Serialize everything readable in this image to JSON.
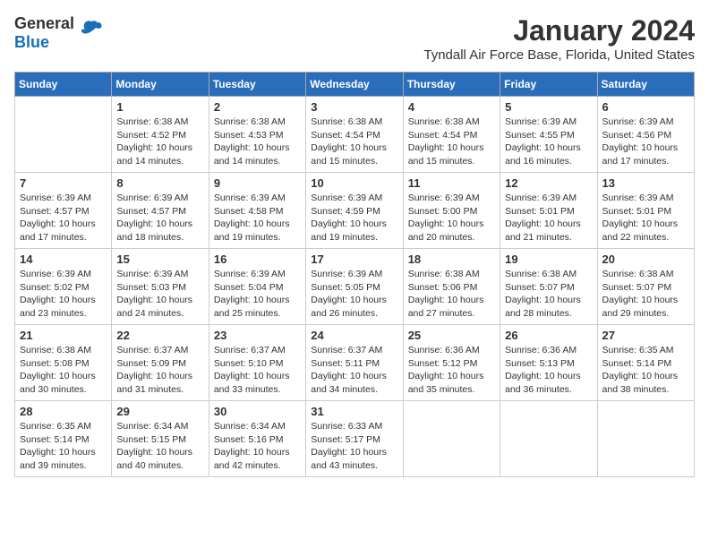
{
  "logo": {
    "general": "General",
    "blue": "Blue"
  },
  "title": "January 2024",
  "location": "Tyndall Air Force Base, Florida, United States",
  "days": [
    "Sunday",
    "Monday",
    "Tuesday",
    "Wednesday",
    "Thursday",
    "Friday",
    "Saturday"
  ],
  "weeks": [
    [
      {
        "date": "",
        "info": ""
      },
      {
        "date": "1",
        "info": "Sunrise: 6:38 AM\nSunset: 4:52 PM\nDaylight: 10 hours\nand 14 minutes."
      },
      {
        "date": "2",
        "info": "Sunrise: 6:38 AM\nSunset: 4:53 PM\nDaylight: 10 hours\nand 14 minutes."
      },
      {
        "date": "3",
        "info": "Sunrise: 6:38 AM\nSunset: 4:54 PM\nDaylight: 10 hours\nand 15 minutes."
      },
      {
        "date": "4",
        "info": "Sunrise: 6:38 AM\nSunset: 4:54 PM\nDaylight: 10 hours\nand 15 minutes."
      },
      {
        "date": "5",
        "info": "Sunrise: 6:39 AM\nSunset: 4:55 PM\nDaylight: 10 hours\nand 16 minutes."
      },
      {
        "date": "6",
        "info": "Sunrise: 6:39 AM\nSunset: 4:56 PM\nDaylight: 10 hours\nand 17 minutes."
      }
    ],
    [
      {
        "date": "7",
        "info": "Sunrise: 6:39 AM\nSunset: 4:57 PM\nDaylight: 10 hours\nand 17 minutes."
      },
      {
        "date": "8",
        "info": "Sunrise: 6:39 AM\nSunset: 4:57 PM\nDaylight: 10 hours\nand 18 minutes."
      },
      {
        "date": "9",
        "info": "Sunrise: 6:39 AM\nSunset: 4:58 PM\nDaylight: 10 hours\nand 19 minutes."
      },
      {
        "date": "10",
        "info": "Sunrise: 6:39 AM\nSunset: 4:59 PM\nDaylight: 10 hours\nand 19 minutes."
      },
      {
        "date": "11",
        "info": "Sunrise: 6:39 AM\nSunset: 5:00 PM\nDaylight: 10 hours\nand 20 minutes."
      },
      {
        "date": "12",
        "info": "Sunrise: 6:39 AM\nSunset: 5:01 PM\nDaylight: 10 hours\nand 21 minutes."
      },
      {
        "date": "13",
        "info": "Sunrise: 6:39 AM\nSunset: 5:01 PM\nDaylight: 10 hours\nand 22 minutes."
      }
    ],
    [
      {
        "date": "14",
        "info": "Sunrise: 6:39 AM\nSunset: 5:02 PM\nDaylight: 10 hours\nand 23 minutes."
      },
      {
        "date": "15",
        "info": "Sunrise: 6:39 AM\nSunset: 5:03 PM\nDaylight: 10 hours\nand 24 minutes."
      },
      {
        "date": "16",
        "info": "Sunrise: 6:39 AM\nSunset: 5:04 PM\nDaylight: 10 hours\nand 25 minutes."
      },
      {
        "date": "17",
        "info": "Sunrise: 6:39 AM\nSunset: 5:05 PM\nDaylight: 10 hours\nand 26 minutes."
      },
      {
        "date": "18",
        "info": "Sunrise: 6:38 AM\nSunset: 5:06 PM\nDaylight: 10 hours\nand 27 minutes."
      },
      {
        "date": "19",
        "info": "Sunrise: 6:38 AM\nSunset: 5:07 PM\nDaylight: 10 hours\nand 28 minutes."
      },
      {
        "date": "20",
        "info": "Sunrise: 6:38 AM\nSunset: 5:07 PM\nDaylight: 10 hours\nand 29 minutes."
      }
    ],
    [
      {
        "date": "21",
        "info": "Sunrise: 6:38 AM\nSunset: 5:08 PM\nDaylight: 10 hours\nand 30 minutes."
      },
      {
        "date": "22",
        "info": "Sunrise: 6:37 AM\nSunset: 5:09 PM\nDaylight: 10 hours\nand 31 minutes."
      },
      {
        "date": "23",
        "info": "Sunrise: 6:37 AM\nSunset: 5:10 PM\nDaylight: 10 hours\nand 33 minutes."
      },
      {
        "date": "24",
        "info": "Sunrise: 6:37 AM\nSunset: 5:11 PM\nDaylight: 10 hours\nand 34 minutes."
      },
      {
        "date": "25",
        "info": "Sunrise: 6:36 AM\nSunset: 5:12 PM\nDaylight: 10 hours\nand 35 minutes."
      },
      {
        "date": "26",
        "info": "Sunrise: 6:36 AM\nSunset: 5:13 PM\nDaylight: 10 hours\nand 36 minutes."
      },
      {
        "date": "27",
        "info": "Sunrise: 6:35 AM\nSunset: 5:14 PM\nDaylight: 10 hours\nand 38 minutes."
      }
    ],
    [
      {
        "date": "28",
        "info": "Sunrise: 6:35 AM\nSunset: 5:14 PM\nDaylight: 10 hours\nand 39 minutes."
      },
      {
        "date": "29",
        "info": "Sunrise: 6:34 AM\nSunset: 5:15 PM\nDaylight: 10 hours\nand 40 minutes."
      },
      {
        "date": "30",
        "info": "Sunrise: 6:34 AM\nSunset: 5:16 PM\nDaylight: 10 hours\nand 42 minutes."
      },
      {
        "date": "31",
        "info": "Sunrise: 6:33 AM\nSunset: 5:17 PM\nDaylight: 10 hours\nand 43 minutes."
      },
      {
        "date": "",
        "info": ""
      },
      {
        "date": "",
        "info": ""
      },
      {
        "date": "",
        "info": ""
      }
    ]
  ]
}
